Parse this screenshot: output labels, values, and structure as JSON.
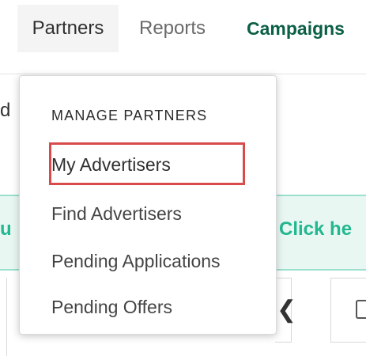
{
  "navigation": {
    "items": [
      {
        "label": "Partners"
      },
      {
        "label": "Reports"
      },
      {
        "label": "Campaigns"
      }
    ]
  },
  "background": {
    "fragment_left": "d",
    "banner_left": "u",
    "banner_right": "Click he",
    "chevron_icon": "chevron-left-icon",
    "square_icon": "square-icon"
  },
  "dropdown": {
    "header": "MANAGE PARTNERS",
    "items": [
      {
        "label": "My Advertisers"
      },
      {
        "label": "Find Advertisers"
      },
      {
        "label": "Pending Applications"
      },
      {
        "label": "Pending Offers"
      }
    ],
    "highlight_color": "#d94b4b"
  },
  "colors": {
    "active_nav_bg": "#f4f4f4",
    "campaigns_text": "#0b5f46",
    "banner_text": "#22b88f",
    "banner_bg": "#e9f7f3"
  }
}
